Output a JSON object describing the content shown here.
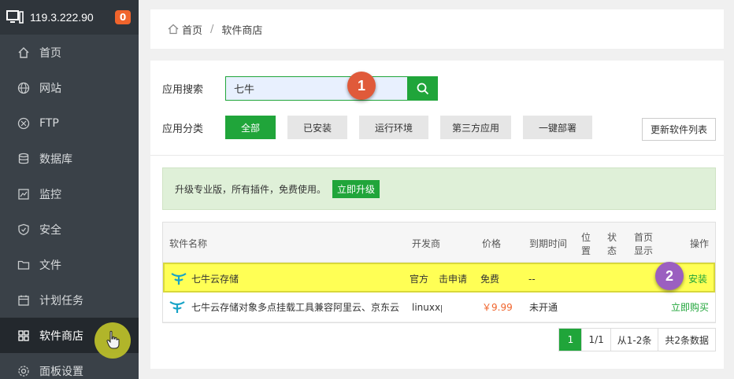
{
  "sidebar": {
    "ip": "119.3.222.90",
    "badge": "0",
    "items": [
      {
        "label": "首页",
        "icon": "home-icon"
      },
      {
        "label": "网站",
        "icon": "globe-icon"
      },
      {
        "label": "FTP",
        "icon": "ftp-icon"
      },
      {
        "label": "数据库",
        "icon": "database-icon"
      },
      {
        "label": "监控",
        "icon": "monitor-chart-icon"
      },
      {
        "label": "安全",
        "icon": "shield-icon"
      },
      {
        "label": "文件",
        "icon": "folder-icon"
      },
      {
        "label": "计划任务",
        "icon": "calendar-icon"
      },
      {
        "label": "软件商店",
        "icon": "grid-icon"
      },
      {
        "label": "面板设置",
        "icon": "gear-icon"
      }
    ]
  },
  "breadcrumb": {
    "home": "首页",
    "sep": "/",
    "current": "软件商店"
  },
  "search": {
    "label": "应用搜索",
    "value": "七牛"
  },
  "category": {
    "label": "应用分类",
    "buttons": [
      "全部",
      "已安装",
      "运行环境",
      "第三方应用",
      "一键部署"
    ]
  },
  "update_button": "更新软件列表",
  "promo": {
    "text": "升级专业版，所有插件，免费使用。",
    "button": "立即升级"
  },
  "table": {
    "headers": {
      "name": "软件名称",
      "dev": "开发商",
      "price": "价格",
      "expire": "到期时间",
      "pos1": "位",
      "pos2": "置",
      "status1": "状",
      "status2": "态",
      "home1": "首页",
      "home2": "显示",
      "action": "操作"
    },
    "rows": [
      {
        "name": "七牛云存储",
        "dev": "官方",
        "dev_extra": "击申请",
        "price": "免费",
        "expire": "--",
        "action": "安装"
      },
      {
        "name": "七牛云存储对象多点挂载工具兼容阿里云、京东云",
        "dev": "linuxxp",
        "price": "￥9.99",
        "expire": "未开通",
        "action": "立即购买"
      }
    ]
  },
  "pager": {
    "current": "1",
    "pages": "1/1",
    "range": "从1-2条",
    "total": "共2条数据"
  },
  "annotations": {
    "one": "1",
    "two": "2"
  },
  "colors": {
    "accent": "#20a53a",
    "sidebar": "#3a4148",
    "highlight": "#ffff55",
    "badge": "#f0642c",
    "marker1": "#e05a3a",
    "marker2": "#9b5fc0"
  }
}
